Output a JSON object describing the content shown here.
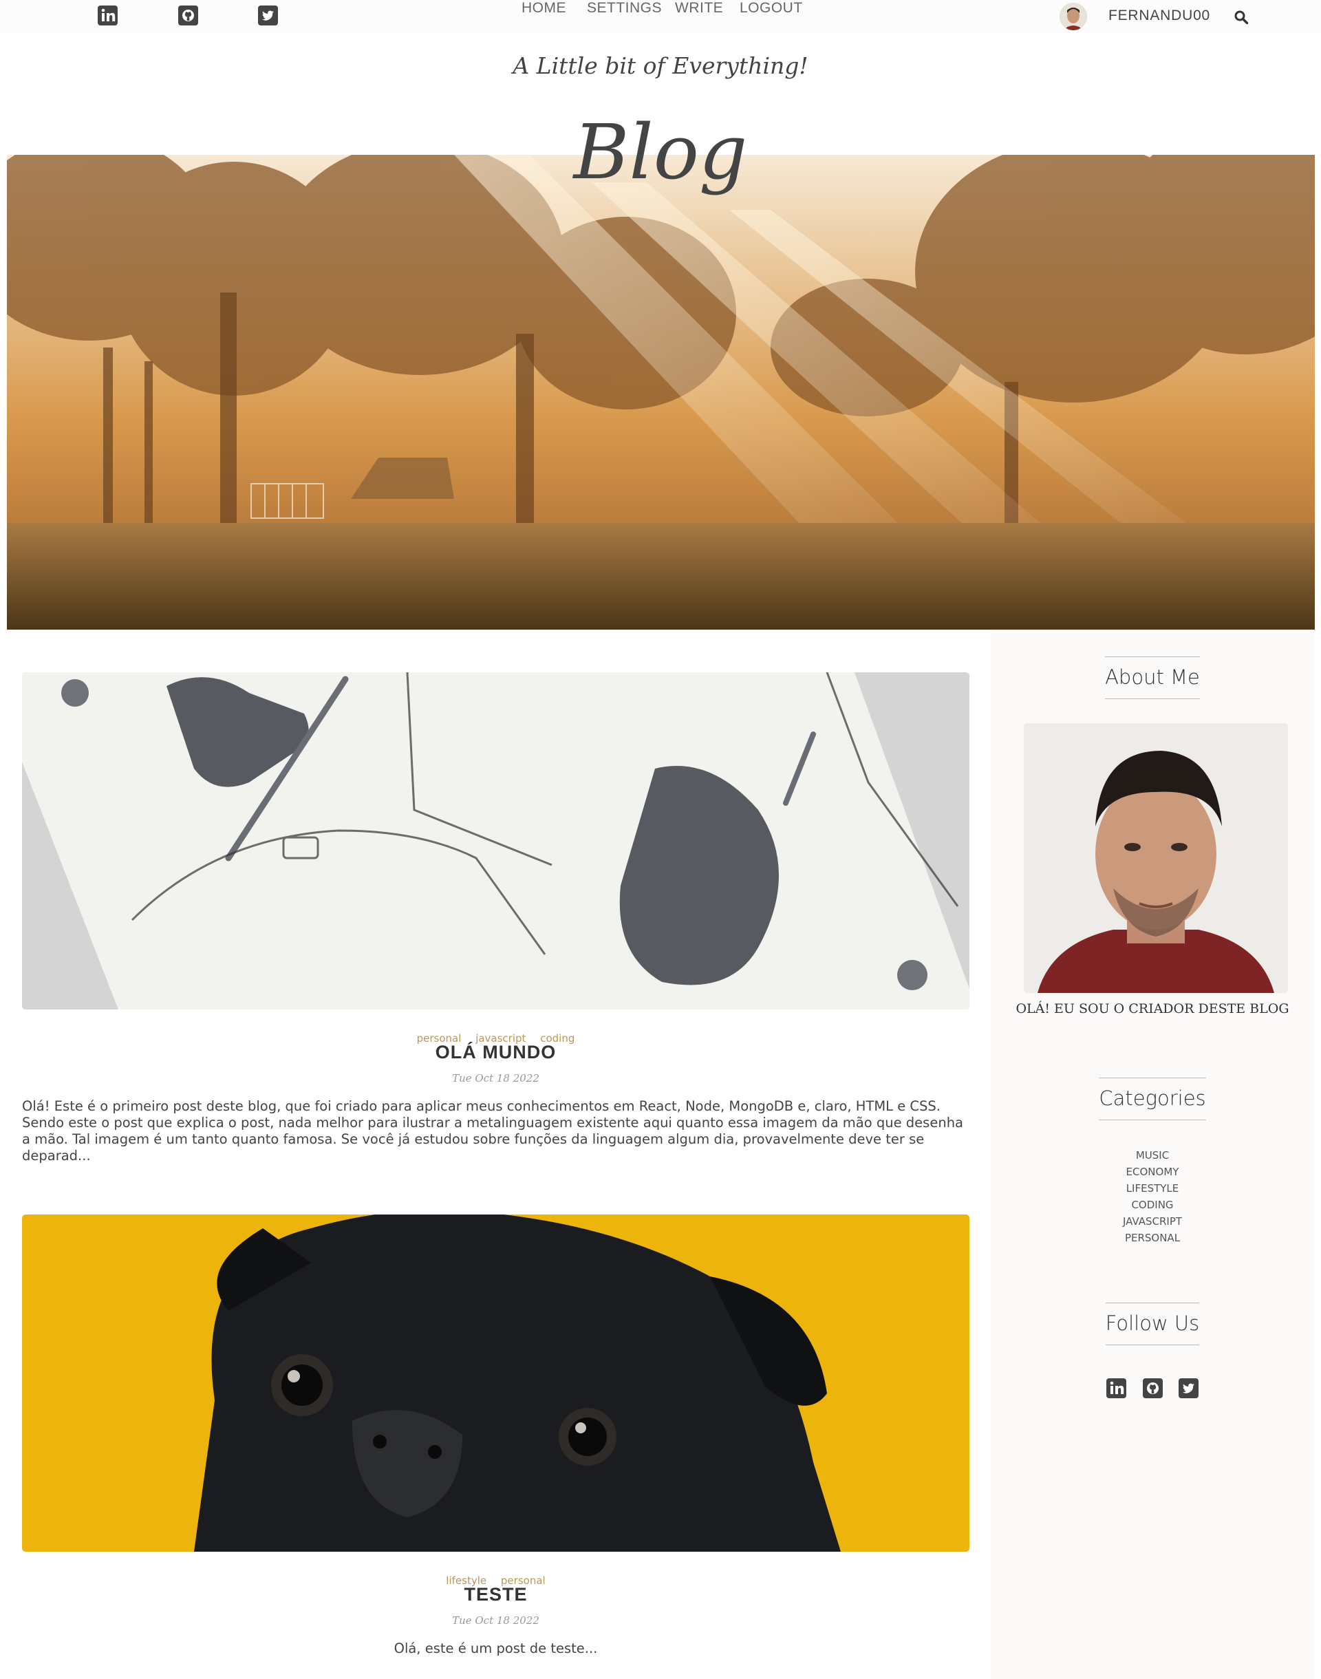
{
  "topbar": {
    "social": [
      "linkedin-icon",
      "github-icon",
      "twitter-icon"
    ],
    "nav": [
      "HOME",
      "SETTINGS",
      "WRITE",
      "LOGOUT"
    ],
    "username": "FERNANDU00"
  },
  "header": {
    "tagline": "A Little bit of Everything!",
    "title": "Blog"
  },
  "posts": [
    {
      "categories": [
        "personal",
        "javascript",
        "coding"
      ],
      "title": "OLÁ MUNDO",
      "date": "Tue Oct 18 2022",
      "excerpt": "Olá! Este é o primeiro post deste blog, que foi criado para aplicar meus conhecimentos em React, Node, MongoDB e, claro, HTML e CSS. Sendo este o post que explica o post, nada melhor para ilustrar a metalinguagem existente aqui quanto essa imagem da mão que desenha a mão. Tal imagem é um tanto quanto famosa. Se você já estudou sobre funções da linguagem algum dia, provavelmente deve ter se deparad..."
    },
    {
      "categories": [
        "lifestyle",
        "personal"
      ],
      "title": "TESTE",
      "date": "Tue Oct 18 2022",
      "excerpt": "Olá, este é um post de teste..."
    }
  ],
  "sidebar": {
    "about_heading": "About Me",
    "about_text": "OLÁ! EU SOU O CRIADOR DESTE BLOG",
    "categories_heading": "Categories",
    "categories": [
      "MUSIC",
      "ECONOMY",
      "LIFESTYLE",
      "CODING",
      "JAVASCRIPT",
      "PERSONAL"
    ],
    "follow_heading": "Follow Us"
  },
  "colors": {
    "accent_category": "#be9656",
    "text_dark": "#444444",
    "sidebar_bg": "#fcf9f9",
    "pug_bg": "#edb40b"
  }
}
